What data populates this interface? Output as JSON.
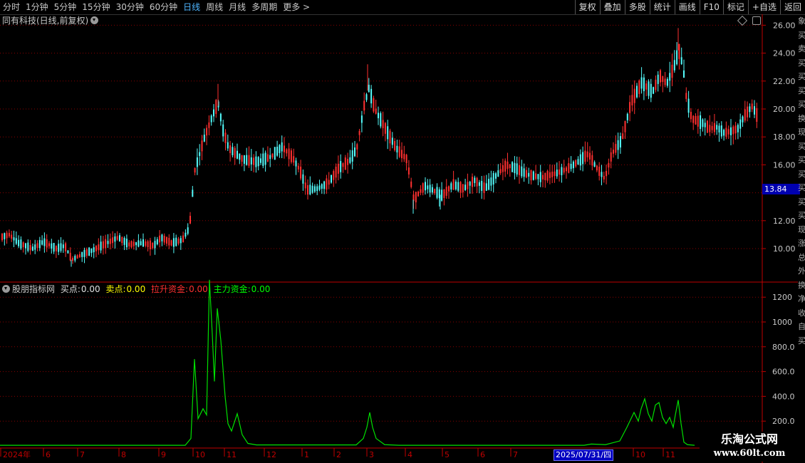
{
  "toolbar": {
    "periods": [
      "分时",
      "1分钟",
      "5分钟",
      "15分钟",
      "30分钟",
      "60分钟",
      "日线",
      "周线",
      "月线",
      "多周期",
      "更多 >"
    ],
    "active_period": "日线",
    "right_buttons": [
      "复权",
      "叠加",
      "多股",
      "统计",
      "画线",
      "F10",
      "标记",
      "+自选",
      "返回"
    ]
  },
  "main_chart": {
    "title": "同有科技(日线,前复权)",
    "y_labels": [
      "26.00",
      "24.00",
      "22.00",
      "20.00",
      "18.00",
      "16.00",
      "12.00",
      "10.00"
    ],
    "current_price": "13.84",
    "colors": {
      "up": "#ff3030",
      "down": "#54fcfc",
      "grid": "#8a0000",
      "axis": "#c00000"
    }
  },
  "indicator": {
    "name": "股朋指标网",
    "buy_label": "买点:",
    "buy_value": "0.00",
    "sell_label": "卖点:",
    "sell_value": "0.00",
    "lift_label": "拉升资金:",
    "lift_value": "0.00",
    "main_label": "主力资金:",
    "main_value": "0.00",
    "y_labels": [
      "1200",
      "1000",
      "800.0",
      "600.0",
      "400.0",
      "200.0"
    ]
  },
  "x_axis": {
    "labels": [
      "2024年",
      "6",
      "7",
      "8",
      "9",
      "10",
      "11",
      "12",
      "1",
      "2",
      "3",
      "4",
      "5",
      "6",
      "7",
      "10",
      "11"
    ],
    "cursor_date": "2025/07/31/四"
  },
  "watermark": {
    "line1": "乐淘公式网",
    "line2": "www.60lt.com"
  },
  "side_strip": [
    "象",
    "买",
    "卖",
    "买",
    "买",
    "买",
    "买",
    "换",
    "现",
    "买",
    "买",
    "买",
    "买",
    "买",
    "买",
    "现",
    "涨",
    "总",
    "外",
    "换",
    "净",
    "收",
    "自",
    "买"
  ]
}
